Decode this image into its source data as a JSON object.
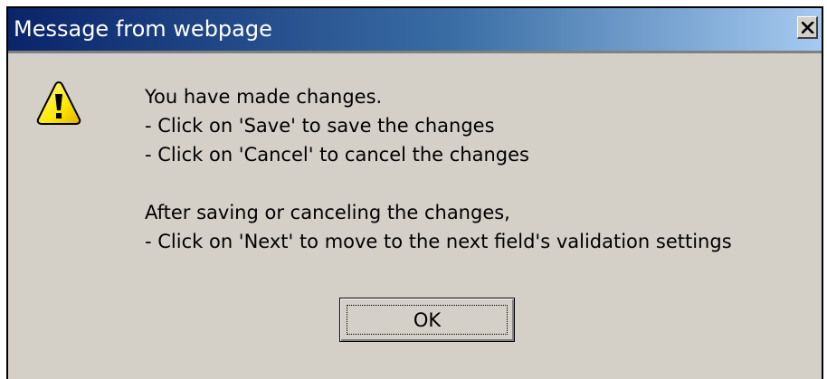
{
  "dialog": {
    "title": "Message from webpage",
    "close_icon": "close-x-icon",
    "warning_icon": "warning-triangle-icon",
    "message_lines": [
      "You have made changes.",
      "- Click on 'Save' to save the changes",
      "- Click on 'Cancel' to cancel the changes",
      "",
      "After saving or canceling the changes,",
      "- Click on 'Next' to move to the next field's validation settings"
    ],
    "ok_label": "OK"
  },
  "colors": {
    "titlebar_start": "#0a246a",
    "titlebar_end": "#a6caf0",
    "dialog_face": "#d4d0c8",
    "warning_yellow": "#ffe800"
  }
}
